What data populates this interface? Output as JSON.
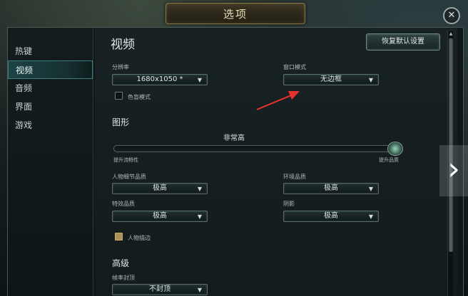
{
  "window": {
    "title": "选项",
    "close_icon": "close-icon"
  },
  "sidebar": {
    "items": [
      {
        "label": "热键"
      },
      {
        "label": "视频",
        "active": true
      },
      {
        "label": "音频"
      },
      {
        "label": "界面"
      },
      {
        "label": "游戏"
      }
    ]
  },
  "video": {
    "title": "视频",
    "reset_label": "恢复默认设置",
    "resolution": {
      "label": "分辨率",
      "value": "1680x1050 *"
    },
    "window_mode": {
      "label": "窗口模式",
      "value": "无边框"
    },
    "colorblind": {
      "label": "色盲模式",
      "checked": false
    }
  },
  "graphics": {
    "title": "图形",
    "quality_value": "非常高",
    "slider_min_label": "提升流畅性",
    "slider_max_label": "提升品质",
    "slider_level": 1.0,
    "character_quality": {
      "label": "人物细节品质",
      "value": "极高"
    },
    "environment_quality": {
      "label": "环境品质",
      "value": "极高"
    },
    "effects_quality": {
      "label": "特效品质",
      "value": "极高"
    },
    "shadows": {
      "label": "阴影",
      "value": "极高"
    },
    "character_outline": {
      "label": "人物描边",
      "checked": true
    }
  },
  "advanced": {
    "title": "高级",
    "frame_rate_cap": {
      "label": "帧率封顶",
      "value": "不封顶"
    }
  },
  "colors": {
    "accent": "#3e7d7e",
    "gold": "#a79157",
    "annotation": "#e8322d"
  }
}
